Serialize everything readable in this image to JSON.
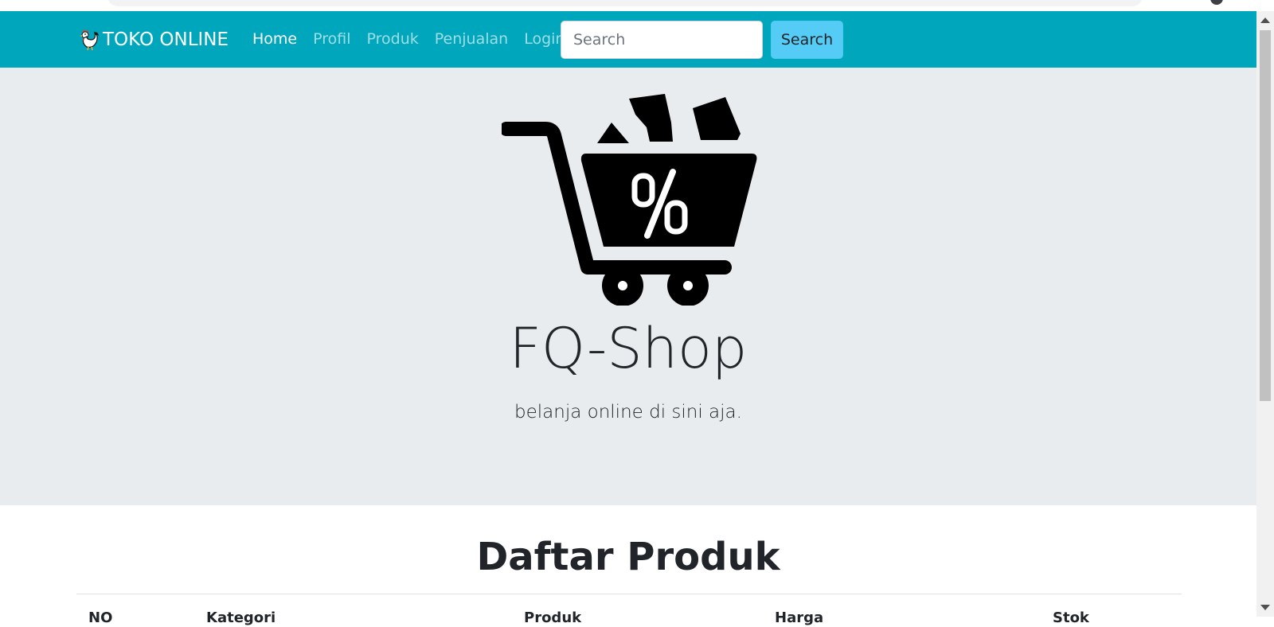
{
  "navbar": {
    "brand": "TOKO ONLINE",
    "brand_icon": "rooster-icon",
    "links": [
      {
        "label": "Home",
        "active": true
      },
      {
        "label": "Profil",
        "active": false
      },
      {
        "label": "Produk",
        "active": false
      },
      {
        "label": "Penjualan",
        "active": false
      },
      {
        "label": "Login",
        "active": false
      }
    ],
    "search_placeholder": "Search",
    "search_button": "Search",
    "background_color": "#00a7bc"
  },
  "hero": {
    "logo_icon": "shopping-cart-discount-icon",
    "title": "FQ-Shop",
    "subtitle": "belanja online di sini aja.",
    "background_color": "#e8ecef"
  },
  "products": {
    "title": "Daftar Produk",
    "columns": [
      "NO",
      "Kategori",
      "Produk",
      "Harga",
      "Stok"
    ]
  }
}
